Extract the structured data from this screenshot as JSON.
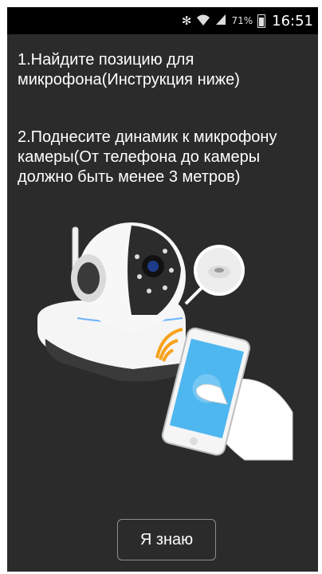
{
  "status_bar": {
    "bluetooth_icon": "bluetooth-icon",
    "wifi_icon": "wifi-icon",
    "signal_icon": "signal-icon",
    "battery_percent": "71%",
    "time": "16:51"
  },
  "instructions": {
    "step1": "1.Найдите позицию для микрофона(Инструкция ниже)",
    "step2": "2.Поднесите динамик к микрофону камеры(От телефона до камеры должно быть менее 3 метров)"
  },
  "illustration": {
    "phone_screen_symbol": "((•))",
    "phone_screen_color": "#4fb7f0",
    "accent_color": "#f7a21b"
  },
  "confirm_button": {
    "label": "Я знаю"
  },
  "colors": {
    "background": "#2b2b2b",
    "status_bar": "#000000",
    "text": "#ffffff"
  }
}
